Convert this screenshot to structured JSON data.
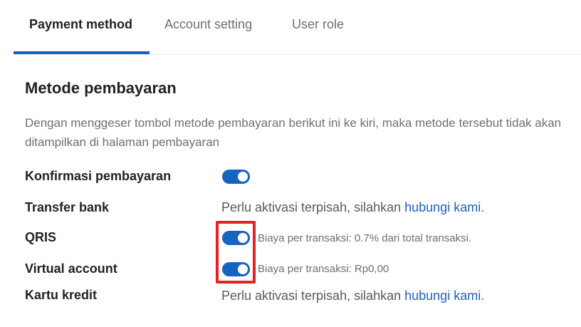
{
  "tabs": [
    {
      "label": "Payment method",
      "active": true
    },
    {
      "label": "Account setting",
      "active": false
    },
    {
      "label": "User role",
      "active": false
    }
  ],
  "section": {
    "title": "Metode pembayaran",
    "description": "Dengan menggeser tombol metode pembayaran berikut ini ke kiri, maka metode tersebut tidak akan ditampilkan di halaman pembayaran"
  },
  "methods": [
    {
      "label": "Konfirmasi pembayaran",
      "toggle_on": true
    },
    {
      "label": "Transfer bank",
      "note": "Perlu aktivasi terpisah, silahkan ",
      "link": "hubungi kami",
      "suffix": "."
    },
    {
      "label": "QRIS",
      "toggle_on": true,
      "fee": "Biaya per transaksi: 0.7% dari total transaksi."
    },
    {
      "label": "Virtual account",
      "toggle_on": true,
      "fee": "Biaya per transaksi: Rp0,00"
    },
    {
      "label": "Kartu kredit",
      "note": "Perlu aktivasi terpisah, silahkan ",
      "link": "hubungi kami",
      "suffix": "."
    }
  ],
  "colors": {
    "accent": "#1565c0",
    "link": "#1e60c8",
    "highlight": "#e32222"
  }
}
